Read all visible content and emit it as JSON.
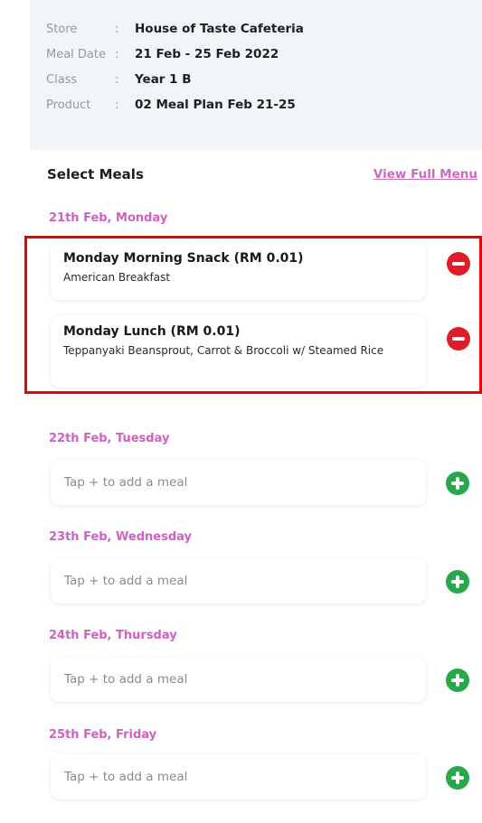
{
  "info": {
    "store_label": "Store",
    "store_value": "House of Taste Cafeteria",
    "meal_date_label": "Meal Date",
    "meal_date_value": "21 Feb - 25 Feb 2022",
    "class_label": "Class",
    "class_value": "Year 1 B",
    "product_label": "Product",
    "product_value": "02 Meal Plan Feb 21-25",
    "separator": ":"
  },
  "select_meals": {
    "title": "Select Meals",
    "view_full_menu": "View Full Menu"
  },
  "days": [
    {
      "label": "21th Feb, Monday",
      "meals": [
        {
          "title": "Monday Morning Snack (RM 0.01)",
          "description": "American Breakfast"
        },
        {
          "title": "Monday Lunch (RM 0.01)",
          "description": "Teppanyaki Beansprout, Carrot & Broccoli w/ Steamed Rice"
        }
      ]
    },
    {
      "label": "22th Feb, Tuesday",
      "placeholder": "Tap + to add a meal"
    },
    {
      "label": "23th Feb, Wednesday",
      "placeholder": "Tap + to add a meal"
    },
    {
      "label": "24th Feb, Thursday",
      "placeholder": "Tap + to add a meal"
    },
    {
      "label": "25th Feb, Friday",
      "placeholder": "Tap + to add a meal"
    }
  ],
  "icons": {
    "remove": "minus-circle-icon",
    "add": "plus-circle-icon"
  },
  "colors": {
    "accent_pink": "#d160c4",
    "remove_red": "#e01c2a",
    "add_green": "#27a84a",
    "info_bg": "#f1f4f8",
    "highlight_red": "#ee0000"
  }
}
